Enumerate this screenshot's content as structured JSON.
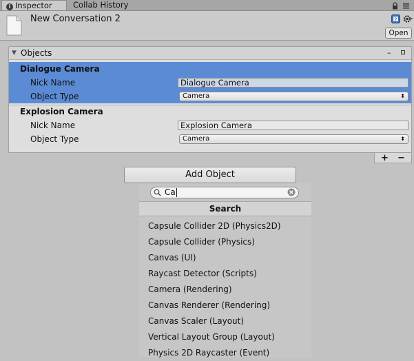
{
  "tabs": [
    {
      "label": "Inspector",
      "icon": "info-icon",
      "active": true
    },
    {
      "label": "Collab History",
      "active": false
    }
  ],
  "header": {
    "title": "New Conversation 2",
    "open_label": "Open"
  },
  "objects_panel": {
    "title": "Objects",
    "items": [
      {
        "name": "Dialogue Camera",
        "nick_label": "Nick Name",
        "nick_value": "Dialogue Camera",
        "type_label": "Object Type",
        "type_value": "Camera",
        "selected": true
      },
      {
        "name": "Explosion Camera",
        "nick_label": "Nick Name",
        "nick_value": "Explosion Camera",
        "type_label": "Object Type",
        "type_value": "Camera",
        "selected": false
      }
    ],
    "add_symbol": "+",
    "remove_symbol": "−"
  },
  "add_object_label": "Add Object",
  "search": {
    "value": "Ca",
    "header": "Search",
    "results": [
      "Capsule Collider 2D (Physics2D)",
      "Capsule Collider (Physics)",
      "Canvas (UI)",
      "Raycast Detector (Scripts)",
      "Camera (Rendering)",
      "Canvas Renderer (Rendering)",
      "Canvas Scaler (Layout)",
      "Vertical Layout Group (Layout)",
      "Physics 2D Raycaster (Event)"
    ]
  },
  "colors": {
    "selection": "#5b8bd4",
    "background": "#c2c2c2"
  }
}
